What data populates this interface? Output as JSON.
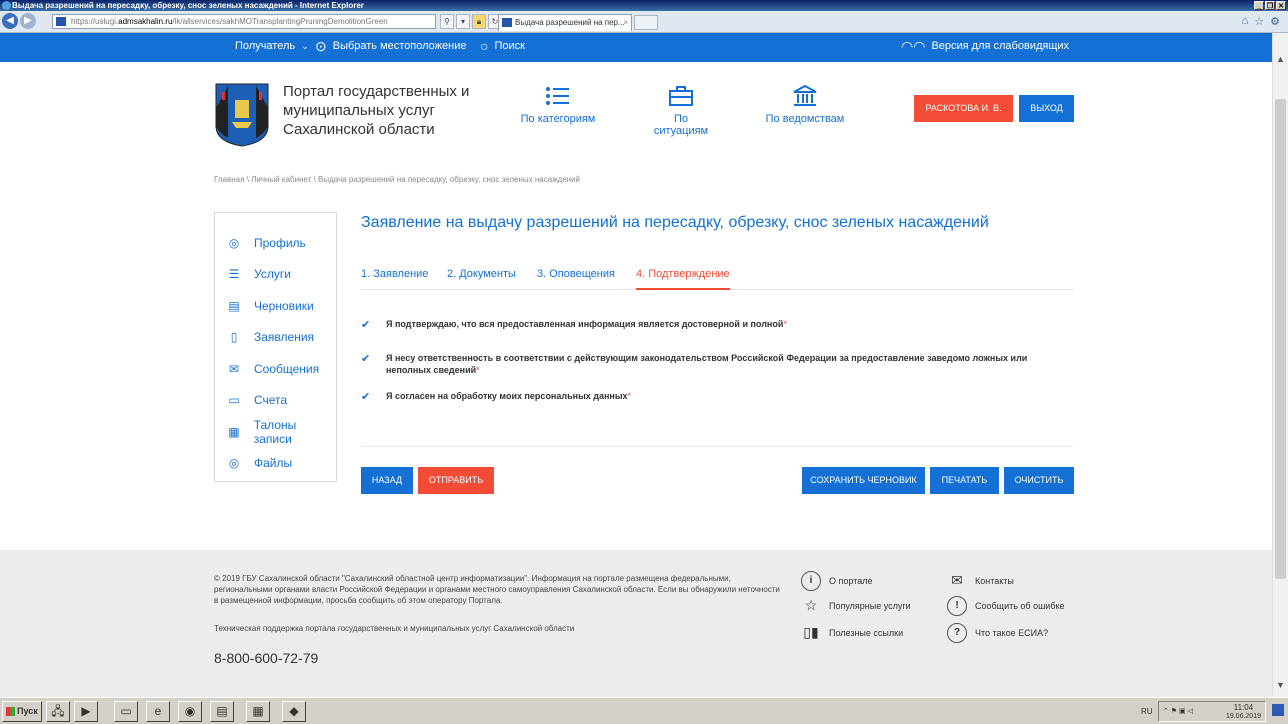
{
  "browser": {
    "window_title": "Выдача разрешений на пересадку, обрезку, снос зеленых насаждений - Internet Explorer",
    "address_prefix": "https://uslugi.",
    "address_domain": "admsakhalin.ru",
    "address_suffix": "/lk/allservices/sakhMOTransplantingPruningDemolitionGreen",
    "tab_title": "Выдача разрешений на пер...",
    "tab_close": "×"
  },
  "topbar": {
    "recipient": "Получатель",
    "location": "Выбрать местоположение",
    "search": "Поиск",
    "accessibility": "Версия для слабовидящих"
  },
  "header": {
    "portal_name": "Портал государственных и муниципальных услуг Сахалинской области",
    "categories": "По категориям",
    "situations": "По ситуациям",
    "departments": "По ведомствам",
    "user_button": "РАСКОТОВА И. В.",
    "exit_button": "ВЫХОД"
  },
  "breadcrumb": {
    "home": "Главная",
    "cabinet": "Личный кабинет",
    "current": "Выдача разрешений на пересадку, обрезку, снос зеленых насаждений",
    "sep": "\\"
  },
  "sidebar": {
    "items": [
      {
        "label": "Профиль",
        "icon": "◎"
      },
      {
        "label": "Услуги",
        "icon": "☰"
      },
      {
        "label": "Черновики",
        "icon": "▤"
      },
      {
        "label": "Заявления",
        "icon": "▯"
      },
      {
        "label": "Сообщения",
        "icon": "✉"
      },
      {
        "label": "Счета",
        "icon": "▭"
      },
      {
        "label": "Талоны записи",
        "icon": "▦"
      },
      {
        "label": "Файлы",
        "icon": "◎"
      }
    ]
  },
  "main": {
    "title": "Заявление на выдачу разрешений на пересадку, обрезку, снос зеленых насаждений",
    "tabs": [
      "1. Заявление",
      "2. Документы",
      "3. Оповещения",
      "4. Подтверждение"
    ],
    "active_tab": 3,
    "checks": [
      "Я подтверждаю, что вся предоставленная информация является достоверной и полной",
      "Я несу ответственность в соответствии с действующим законодательством Российской Федерации за предоставление заведомо ложных или неполных сведений",
      "Я согласен на обработку моих персональных данных"
    ],
    "required_mark": "*",
    "buttons": {
      "back": "НАЗАД",
      "send": "ОТПРАВИТЬ",
      "save_draft": "СОХРАНИТЬ ЧЕРНОВИК",
      "print": "ПЕЧАТАТЬ",
      "clear": "ОЧИСТИТЬ"
    }
  },
  "footer": {
    "copyright": "© 2019 ГБУ Сахалинской области \"Сахалинский областной центр информатизации\". Информация на портале размещена федеральными, региональными органами власти Российской Федерации и органами местного самоуправления Сахалинской области. Если вы обнаружили неточности в размещенной информации, просьба сообщить об этом оператору Портала.",
    "support": "Техническая поддержка портала государственных и муниципальных услуг Сахалинской области",
    "phone": "8-800-600-72-79",
    "links": {
      "about": "О портале",
      "contacts": "Контакты",
      "popular": "Популярные услуги",
      "report_error": "Сообщить об ошибке",
      "useful_links": "Полезные ссылки",
      "esia": "Что такое ЕСИА?"
    }
  },
  "taskbar": {
    "start": "Пуск",
    "lang": "RU",
    "time": "11:04",
    "date": "19.06.2019"
  },
  "colors": {
    "brand_blue": "#1470d4",
    "accent_red": "#f24c37"
  }
}
